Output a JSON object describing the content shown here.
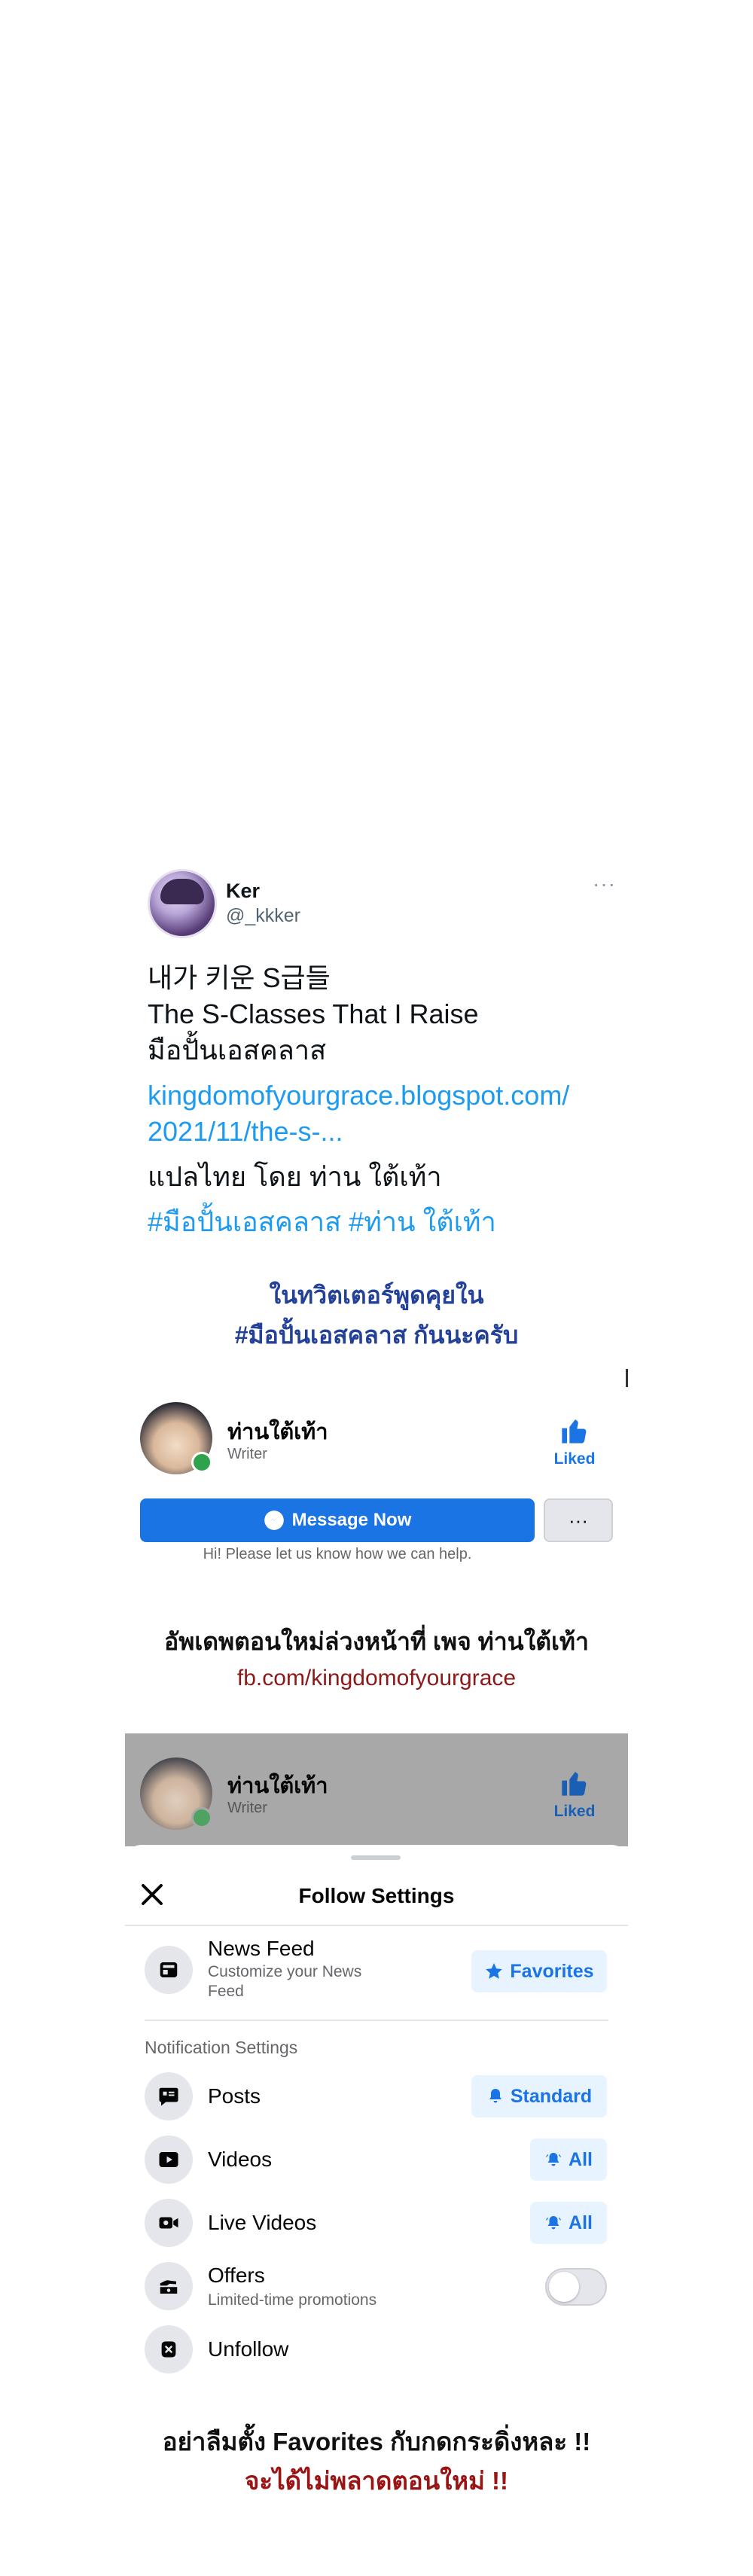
{
  "tweet": {
    "name": "Ker",
    "handle": "@_kkker",
    "more": "···",
    "lines": [
      "내가 키운 S급들",
      "The S-Classes That I Raise",
      "มือปั้นเอสคลาส"
    ],
    "link_line1": "kingdomofyourgrace.blogspot.com/",
    "link_line2": "2021/11/the-s-...",
    "credit": "แปลไทย โดย ท่าน ใต้เท้า",
    "hashtags": "#มือปั้นเอสคลาส #ท่าน ใต้เท้า"
  },
  "promo_twitter": {
    "line1": "ในทวิตเตอร์พูดคุยใน",
    "line2": "#มือปั้นเอสคลาส กันนะครับ"
  },
  "fb_page": {
    "name": "ท่านใต้เท้า",
    "role": "Writer",
    "liked": "Liked",
    "message_button": "Message Now",
    "more_button": "···",
    "hint": "Hi! Please let us know how we can help."
  },
  "promo_fb": {
    "line1": "อัพเดพตอนใหม่ล่วงหน้าที่ เพจ ท่านใต้เท้า",
    "line2": "fb.com/kingdomofyourgrace"
  },
  "follow_settings": {
    "page_name": "ท่านใต้เท้า",
    "page_role": "Writer",
    "liked": "Liked",
    "title": "Follow Settings",
    "news_feed": {
      "title": "News Feed",
      "sub1": "Customize your News",
      "sub2": "Feed",
      "button": "Favorites"
    },
    "notification_label": "Notification Settings",
    "posts": {
      "title": "Posts",
      "button": "Standard"
    },
    "videos": {
      "title": "Videos",
      "button": "All"
    },
    "live_videos": {
      "title": "Live Videos",
      "button": "All"
    },
    "offers": {
      "title": "Offers",
      "sub": "Limited-time promotions",
      "enabled": false
    },
    "unfollow": {
      "title": "Unfollow"
    }
  },
  "closing": {
    "line1": "อย่าลืมตั้ง Favorites กับกดกระดิ่งหละ !!",
    "line2": "จะได้ไม่พลาดตอนใหม่ !!"
  },
  "colors": {
    "fb_blue": "#1b74e4",
    "twitter_blue": "#1d9bf0",
    "accent_red": "#9b1414"
  }
}
